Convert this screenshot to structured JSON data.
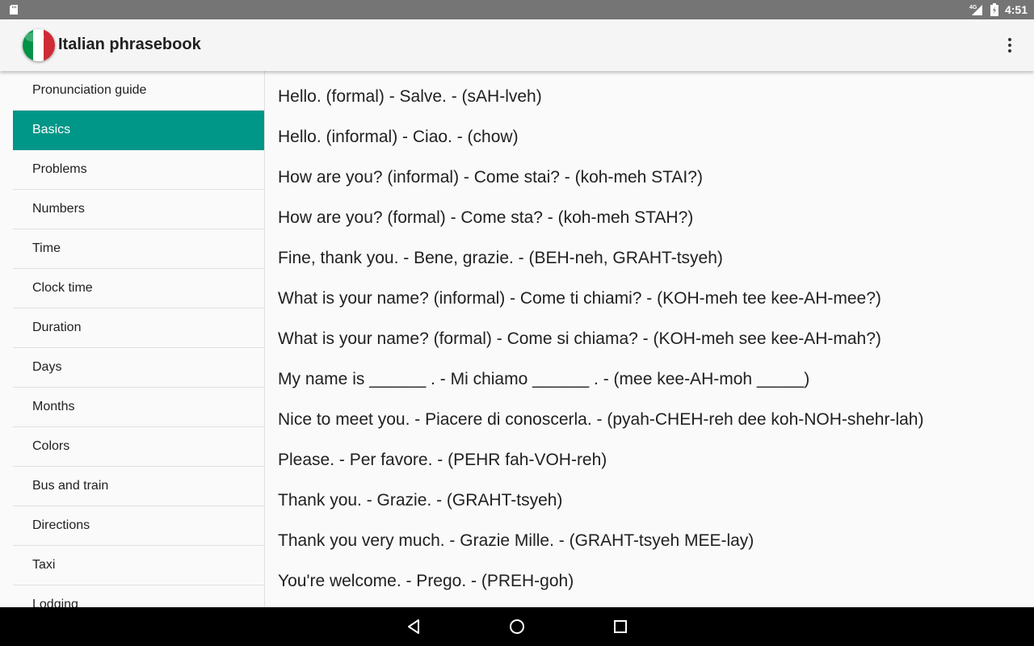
{
  "status_bar": {
    "time": "4:51",
    "network": "4G"
  },
  "app_bar": {
    "title": "Italian phrasebook"
  },
  "colors": {
    "accent": "#009688",
    "flag_green": "#009246",
    "flag_white": "#ffffff",
    "flag_red": "#ce2b37"
  },
  "sidebar": {
    "items": [
      {
        "label": "Pronunciation guide",
        "active": false
      },
      {
        "label": "Basics",
        "active": true
      },
      {
        "label": "Problems",
        "active": false
      },
      {
        "label": "Numbers",
        "active": false
      },
      {
        "label": "Time",
        "active": false
      },
      {
        "label": "Clock time",
        "active": false
      },
      {
        "label": "Duration",
        "active": false
      },
      {
        "label": "Days",
        "active": false
      },
      {
        "label": "Months",
        "active": false
      },
      {
        "label": "Colors",
        "active": false
      },
      {
        "label": "Bus and train",
        "active": false
      },
      {
        "label": "Directions",
        "active": false
      },
      {
        "label": "Taxi",
        "active": false
      },
      {
        "label": "Lodging",
        "active": false
      }
    ]
  },
  "phrases": [
    "Hello. (formal) - Salve. - (sAH-lveh)",
    "Hello. (informal) - Ciao. - (chow)",
    "How are you? (informal) - Come stai? - (koh-meh STAI?)",
    "How are you? (formal) - Come sta? - (koh-meh STAH?)",
    "Fine, thank you. - Bene, grazie. - (BEH-neh, GRAHT-tsyeh)",
    "What is your name? (informal) - Come ti chiami? - (KOH-meh tee kee-AH-mee?)",
    "What is your name? (formal) - Come si chiama? - (KOH-meh see kee-AH-mah?)",
    "My name is ______ . - Mi chiamo ______ . - (mee kee-AH-moh _____)",
    "Nice to meet you. - Piacere di conoscerla. - (pyah-CHEH-reh dee koh-NOH-shehr-lah)",
    "Please. - Per favore. - (PEHR fah-VOH-reh)",
    "Thank you. - Grazie. - (GRAHT-tsyeh)",
    "Thank you very much. - Grazie Mille. - (GRAHT-tsyeh MEE-lay)",
    "You're welcome. - Prego. - (PREH-goh)"
  ],
  "icons": {
    "status_sd": "sd-card-icon",
    "status_signal": "signal-icon",
    "status_battery": "battery-icon",
    "overflow": "more-vert-icon",
    "back": "back-icon",
    "home": "home-icon",
    "recents": "recents-icon"
  }
}
